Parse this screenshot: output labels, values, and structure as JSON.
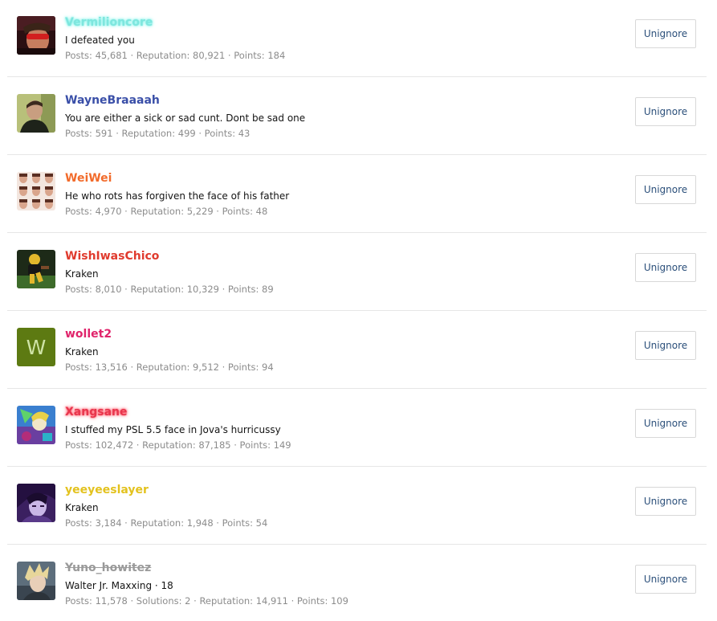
{
  "members": [
    {
      "username": "Vermilioncore",
      "username_color": "#7ee6de",
      "status": "I defeated you",
      "stats": "Posts: 45,681 · Reputation: 80,921 · Points: 184",
      "button_label": "Unignore",
      "avatar_icon": "sunglasses-portrait"
    },
    {
      "username": "WayneBraaaah",
      "username_color": "#3a4fa8",
      "status": "You are either a sick or sad cunt. Dont be sad one",
      "stats": "Posts: 591 · Reputation: 499 · Points: 43",
      "button_label": "Unignore",
      "avatar_icon": "man-portrait"
    },
    {
      "username": "WeiWei",
      "username_color": "#f26b2b",
      "status": "He who rots has forgiven the face of his father",
      "stats": "Posts: 4,970 · Reputation: 5,229 · Points: 48",
      "button_label": "Unignore",
      "avatar_icon": "photo-grid"
    },
    {
      "username": "WishIwasChico",
      "username_color": "#e03b2e",
      "status": "Kraken",
      "stats": "Posts: 8,010 · Reputation: 10,329 · Points: 89",
      "button_label": "Unignore",
      "avatar_icon": "football-player"
    },
    {
      "username": "wollet2",
      "username_color": "#e0246b",
      "status": "Kraken",
      "stats": "Posts: 13,516 · Reputation: 9,512 · Points: 94",
      "button_label": "Unignore",
      "avatar_letter": "W",
      "avatar_color": "#5d7a12"
    },
    {
      "username": "Xangsane",
      "username_color": "#e8364d",
      "status": "I stuffed my PSL 5.5 face in Jova's hurricussy",
      "stats": "Posts: 102,472 · Reputation: 87,185 · Points: 149",
      "button_label": "Unignore",
      "avatar_icon": "anime-art"
    },
    {
      "username": "yeeyeeslayer",
      "username_color": "#e3c21e",
      "status": "Kraken",
      "stats": "Posts: 3,184 · Reputation: 1,948 · Points: 54",
      "button_label": "Unignore",
      "avatar_icon": "anime-character"
    },
    {
      "username": "Yuno_howitez",
      "username_color": "#9a9a9a",
      "status": "Walter Jr. Maxxing · 18",
      "stats": "Posts: 11,578 · Solutions: 2 · Reputation: 14,911 · Points: 109",
      "button_label": "Unignore",
      "avatar_icon": "blond-character"
    }
  ]
}
